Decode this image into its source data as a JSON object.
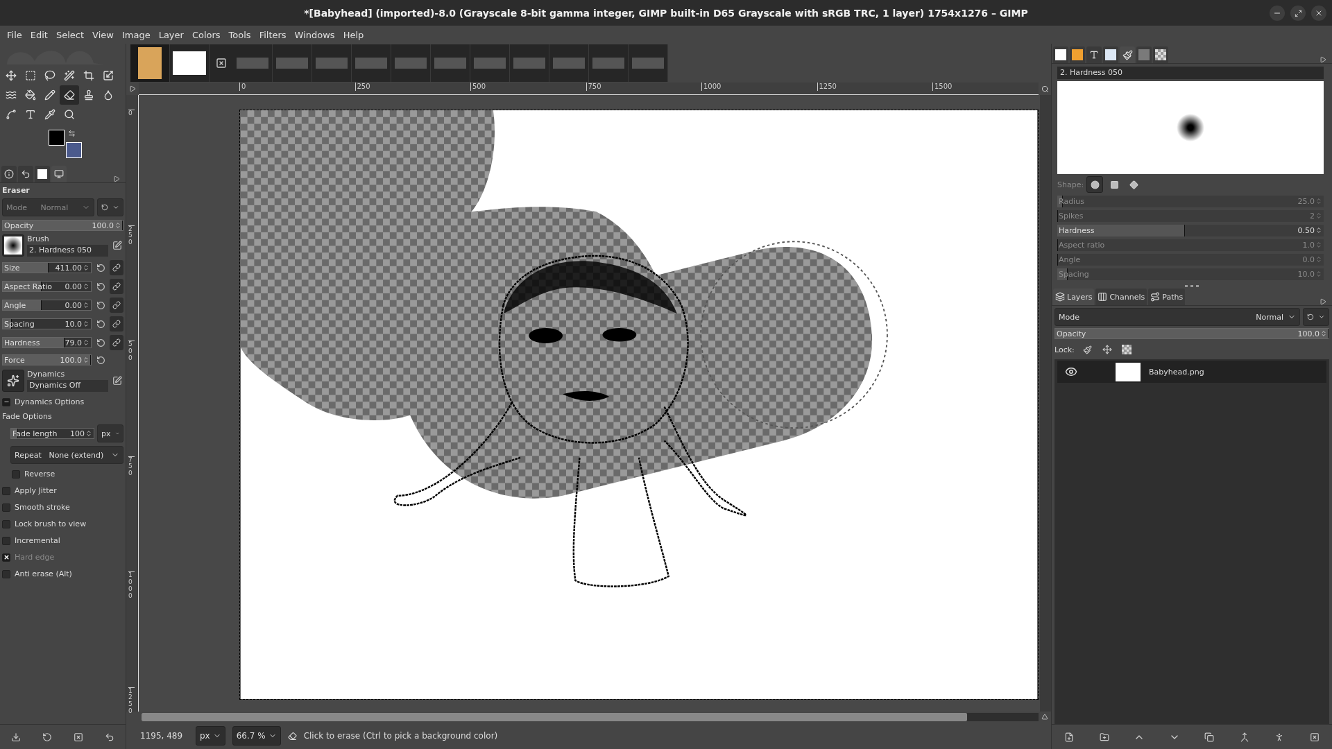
{
  "window": {
    "title": "*[Babyhead] (imported)-8.0 (Grayscale 8-bit gamma integer, GIMP built-in D65 Grayscale with sRGB TRC, 1 layer) 1754x1276 – GIMP"
  },
  "menu": [
    "File",
    "Edit",
    "Select",
    "View",
    "Image",
    "Layer",
    "Colors",
    "Tools",
    "Filters",
    "Windows",
    "Help"
  ],
  "toolbox": {
    "tools": [
      {
        "selected": false
      },
      {
        "selected": false
      },
      {
        "selected": false
      },
      {
        "selected": false
      },
      {
        "selected": false
      },
      {
        "selected": false
      },
      {
        "selected": false
      },
      {
        "selected": false
      },
      {
        "selected": false
      },
      {
        "selected": true
      },
      {
        "selected": false
      },
      {
        "selected": false
      },
      {
        "selected": false
      },
      {
        "selected": false
      },
      {
        "selected": false
      },
      {
        "selected": false
      }
    ]
  },
  "tool_options": {
    "tabs": [
      {
        "selected": false
      },
      {
        "selected": false
      },
      {
        "selected": false
      },
      {
        "selected": true
      }
    ],
    "title": "Eraser",
    "mode": {
      "label": "Mode",
      "value": "Normal"
    },
    "opacity": {
      "label": "Opacity",
      "value": "100.0",
      "level": 1
    },
    "brush": {
      "label": "Brush",
      "value": "2. Hardness 050"
    },
    "sliders": [
      {
        "label": "Size",
        "value": "411.00",
        "level": 0.52
      },
      {
        "label": "Aspect Ratio",
        "value": "0.00",
        "level": 0.44
      },
      {
        "label": "Angle",
        "value": "0.00",
        "level": 0.44
      },
      {
        "label": "Spacing",
        "value": "10.0",
        "level": 0.1
      },
      {
        "label": "Hardness",
        "value": "79.0",
        "level": 0.7
      }
    ],
    "force": {
      "label": "Force",
      "value": "100.0",
      "level": 1
    },
    "dynamics": {
      "label": "Dynamics",
      "value": "Dynamics Off"
    },
    "dynamics_options": {
      "label": "Dynamics Options",
      "expanded": true
    },
    "fade_options": {
      "label": "Fade Options",
      "fade_length": {
        "label": "Fade length",
        "value": "100",
        "level": 0.08
      },
      "unit": "px",
      "repeat": {
        "label": "Repeat",
        "value": "None (extend)"
      },
      "reverse": {
        "label": "Reverse",
        "checked": false
      }
    },
    "options": [
      {
        "label": "Apply Jitter",
        "checked": false,
        "disabled": false
      },
      {
        "label": "Smooth stroke",
        "checked": false,
        "disabled": false
      },
      {
        "label": "Lock brush to view",
        "checked": false,
        "disabled": false
      },
      {
        "label": "Incremental",
        "checked": false,
        "disabled": false
      },
      {
        "label": "Hard edge",
        "checked": true,
        "disabled": true
      },
      {
        "label": "Anti erase  (Alt)",
        "checked": false,
        "disabled": false
      }
    ]
  },
  "image_tabs": [
    {
      "selected": true
    },
    {
      "selected": false
    },
    {
      "selected": false
    },
    {
      "selected": false
    },
    {
      "selected": false
    },
    {
      "selected": false
    },
    {
      "selected": false
    },
    {
      "selected": false
    },
    {
      "selected": false
    },
    {
      "selected": false
    },
    {
      "selected": false
    },
    {
      "selected": false
    },
    {
      "selected": false
    }
  ],
  "ruler": {
    "horizontal": [
      "0",
      "250",
      "500",
      "750",
      "1000",
      "1250",
      "1500"
    ],
    "vertical": [
      "0",
      "250",
      "500",
      "750",
      "1000",
      "1250"
    ]
  },
  "status_bar": {
    "coordinates": "1195, 489",
    "unit": "px",
    "zoom": "66.7 %",
    "message": "Click to erase (Ctrl to pick a background color)"
  },
  "brushes_dock": {
    "tabs": [
      {
        "selected": false
      },
      {
        "selected": false
      },
      {
        "selected": false
      },
      {
        "selected": false
      },
      {
        "selected": true
      },
      {
        "selected": false
      },
      {
        "selected": false
      }
    ],
    "brush_name": "2. Hardness 050",
    "shape": {
      "label": "Shape:",
      "options": [
        {
          "selected": true
        },
        {
          "selected": false
        },
        {
          "selected": false
        }
      ]
    },
    "params": [
      {
        "label": "Radius",
        "value": "25.0",
        "level": 0.02,
        "disabled": true
      },
      {
        "label": "Spikes",
        "value": "2",
        "level": 0,
        "disabled": true
      },
      {
        "label": "Hardness",
        "value": "0.50",
        "level": 0.48,
        "disabled": false
      },
      {
        "label": "Aspect ratio",
        "value": "1.0",
        "level": 0,
        "disabled": true
      },
      {
        "label": "Angle",
        "value": "0.0",
        "level": 0,
        "disabled": true
      },
      {
        "label": "Spacing",
        "value": "10.0",
        "level": 0.04,
        "disabled": true
      }
    ]
  },
  "layers_dock": {
    "tabs": [
      {
        "label": "Layers",
        "selected": true
      },
      {
        "label": "Channels",
        "selected": false
      },
      {
        "label": "Paths",
        "selected": false
      }
    ],
    "mode": {
      "label": "Mode",
      "value": "Normal"
    },
    "opacity": {
      "label": "Opacity",
      "value": "100.0",
      "level": 1
    },
    "lock_label": "Lock:",
    "layers": [
      {
        "name": "Babyhead.png",
        "visible": true,
        "selected": true
      }
    ]
  }
}
